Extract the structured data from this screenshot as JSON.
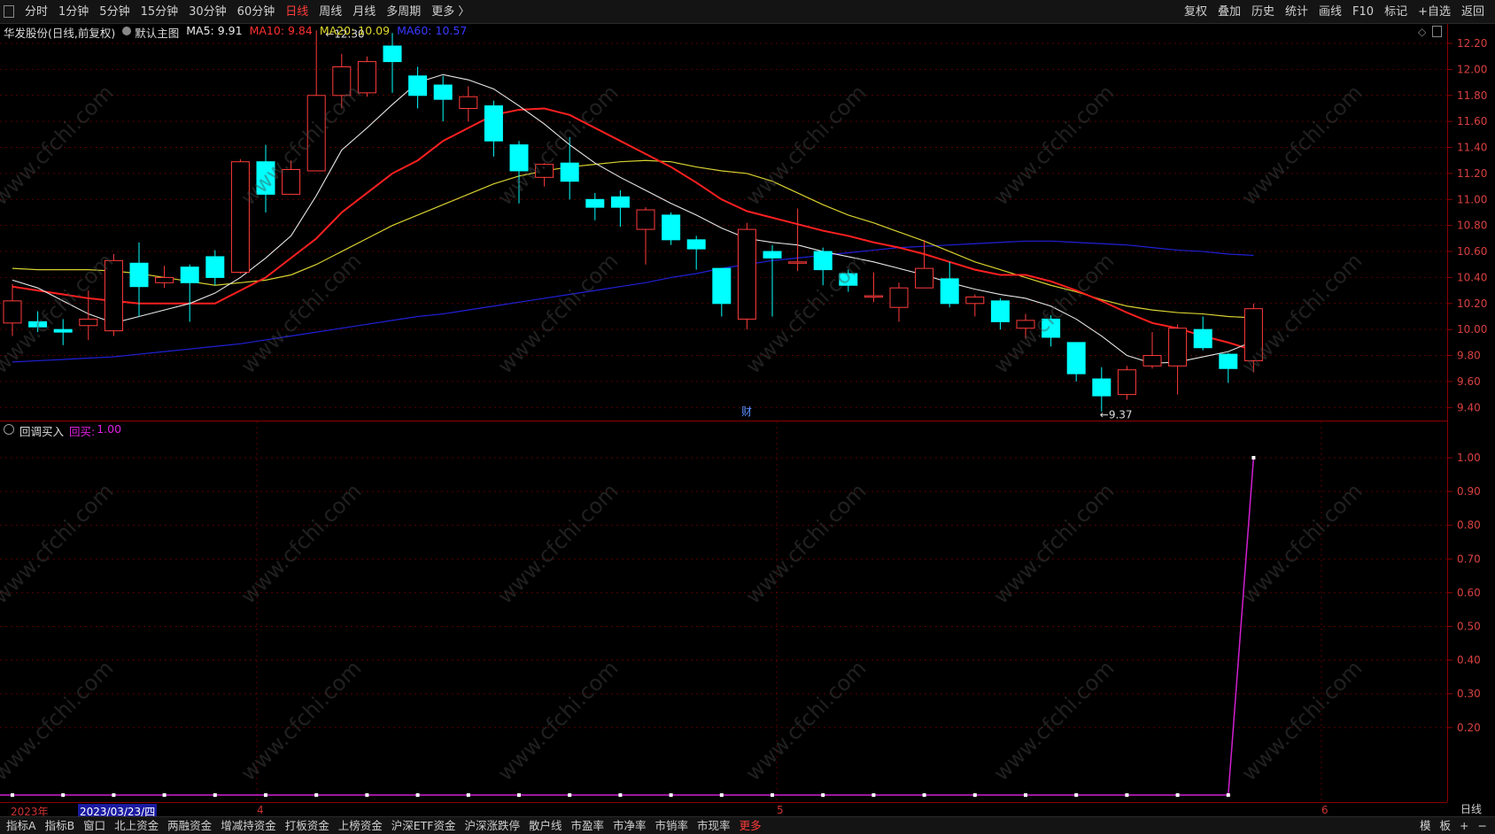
{
  "toolbar": {
    "left": [
      "分时",
      "1分钟",
      "5分钟",
      "15分钟",
      "30分钟",
      "60分钟",
      "日线",
      "周线",
      "月线",
      "多周期",
      "更多 〉"
    ],
    "active": "日线",
    "right": [
      "复权",
      "叠加",
      "历史",
      "统计",
      "画线",
      "F10",
      "标记",
      "+自选",
      "返回"
    ]
  },
  "infobar": {
    "stock": "华发股份",
    "mode": "(日线,前复权)",
    "template": "默认主图",
    "ma5": "MA5: 9.91",
    "ma10": "MA10: 9.84",
    "ma20": "MA20: 10.09",
    "ma60": "MA60: 10.57"
  },
  "colors": {
    "up": "#ff3b3b",
    "down": "#00ffff",
    "ma5": "#e8e8e8",
    "ma10": "#ff2020",
    "ma20": "#d8d030",
    "ma60": "#2020d8",
    "signal": "#d020d0"
  },
  "price_axis": [
    "12.20",
    "12.00",
    "11.80",
    "11.60",
    "11.40",
    "11.20",
    "11.00",
    "10.80",
    "10.60",
    "10.40",
    "10.20",
    "10.00",
    "9.80",
    "9.60",
    "9.40"
  ],
  "annotations": {
    "high": "12.30",
    "low": "9.37",
    "cai": "财"
  },
  "indicator": {
    "name": "回调买入",
    "label": "回买:",
    "value": "1.00"
  },
  "indicator_axis": [
    "1.00",
    "0.90",
    "0.80",
    "0.70",
    "0.60",
    "0.50",
    "0.40",
    "0.30",
    "0.20"
  ],
  "dates": {
    "year": "2023年",
    "selected": "2023/03/23/四",
    "m4": "4",
    "m5": "5",
    "m6": "6"
  },
  "day_label": "日线",
  "bottom_tabs": [
    "指标A",
    "指标B",
    "窗口",
    "北上资金",
    "两融资金",
    "增减持资金",
    "打板资金",
    "上榜资金",
    "沪深ETF资金",
    "沪深涨跌停",
    "散户线",
    "市盈率",
    "市净率",
    "市销率",
    "市现率",
    "更多"
  ],
  "bottom_right": [
    "模",
    "板",
    "+",
    "−"
  ],
  "watermark": "www.cfchi.com",
  "chart_data": {
    "type": "candlestick",
    "ylim": [
      9.3,
      12.35
    ],
    "candles": [
      {
        "o": 10.05,
        "c": 10.22,
        "h": 10.35,
        "l": 9.95
      },
      {
        "o": 10.06,
        "c": 10.02,
        "h": 10.14,
        "l": 9.98
      },
      {
        "o": 10.0,
        "c": 9.98,
        "h": 10.08,
        "l": 9.88
      },
      {
        "o": 10.03,
        "c": 10.08,
        "h": 10.3,
        "l": 9.92
      },
      {
        "o": 9.99,
        "c": 10.53,
        "h": 10.58,
        "l": 9.95
      },
      {
        "o": 10.51,
        "c": 10.33,
        "h": 10.67,
        "l": 10.1
      },
      {
        "o": 10.36,
        "c": 10.4,
        "h": 10.49,
        "l": 10.32
      },
      {
        "o": 10.48,
        "c": 10.36,
        "h": 10.5,
        "l": 10.06
      },
      {
        "o": 10.56,
        "c": 10.4,
        "h": 10.61,
        "l": 10.34
      },
      {
        "o": 10.44,
        "c": 11.29,
        "h": 11.31,
        "l": 10.43
      },
      {
        "o": 11.29,
        "c": 11.04,
        "h": 11.42,
        "l": 10.9
      },
      {
        "o": 11.04,
        "c": 11.23,
        "h": 11.3,
        "l": 11.04
      },
      {
        "o": 11.22,
        "c": 11.8,
        "h": 12.3,
        "l": 11.22
      },
      {
        "o": 11.8,
        "c": 12.02,
        "h": 12.12,
        "l": 11.7
      },
      {
        "o": 11.82,
        "c": 12.06,
        "h": 12.1,
        "l": 11.79
      },
      {
        "o": 12.18,
        "c": 12.06,
        "h": 12.28,
        "l": 11.82
      },
      {
        "o": 11.95,
        "c": 11.8,
        "h": 12.02,
        "l": 11.7
      },
      {
        "o": 11.88,
        "c": 11.77,
        "h": 11.95,
        "l": 11.6
      },
      {
        "o": 11.7,
        "c": 11.79,
        "h": 11.87,
        "l": 11.6
      },
      {
        "o": 11.72,
        "c": 11.45,
        "h": 11.76,
        "l": 11.33
      },
      {
        "o": 11.42,
        "c": 11.22,
        "h": 11.45,
        "l": 10.97
      },
      {
        "o": 11.17,
        "c": 11.27,
        "h": 11.28,
        "l": 11.1
      },
      {
        "o": 11.28,
        "c": 11.14,
        "h": 11.48,
        "l": 11.0
      },
      {
        "o": 11.0,
        "c": 10.94,
        "h": 11.05,
        "l": 10.84
      },
      {
        "o": 11.02,
        "c": 10.94,
        "h": 11.07,
        "l": 10.79
      },
      {
        "o": 10.77,
        "c": 10.92,
        "h": 10.94,
        "l": 10.5
      },
      {
        "o": 10.88,
        "c": 10.69,
        "h": 10.9,
        "l": 10.65
      },
      {
        "o": 10.69,
        "c": 10.62,
        "h": 10.72,
        "l": 10.46
      },
      {
        "o": 10.47,
        "c": 10.2,
        "h": 10.47,
        "l": 10.1
      },
      {
        "o": 10.08,
        "c": 10.77,
        "h": 10.82,
        "l": 10.0
      },
      {
        "o": 10.6,
        "c": 10.55,
        "h": 10.65,
        "l": 10.1
      },
      {
        "o": 10.52,
        "c": 10.52,
        "h": 10.93,
        "l": 10.45
      },
      {
        "o": 10.6,
        "c": 10.46,
        "h": 10.63,
        "l": 10.34
      },
      {
        "o": 10.43,
        "c": 10.34,
        "h": 10.46,
        "l": 10.29
      },
      {
        "o": 10.26,
        "c": 10.26,
        "h": 10.44,
        "l": 10.21
      },
      {
        "o": 10.17,
        "c": 10.32,
        "h": 10.36,
        "l": 10.06
      },
      {
        "o": 10.32,
        "c": 10.47,
        "h": 10.69,
        "l": 10.32
      },
      {
        "o": 10.39,
        "c": 10.2,
        "h": 10.52,
        "l": 10.17
      },
      {
        "o": 10.2,
        "c": 10.25,
        "h": 10.27,
        "l": 10.1
      },
      {
        "o": 10.22,
        "c": 10.06,
        "h": 10.24,
        "l": 10.0
      },
      {
        "o": 10.01,
        "c": 10.07,
        "h": 10.12,
        "l": 9.93
      },
      {
        "o": 10.08,
        "c": 9.94,
        "h": 10.11,
        "l": 9.87
      },
      {
        "o": 9.9,
        "c": 9.66,
        "h": 9.9,
        "l": 9.6
      },
      {
        "o": 9.62,
        "c": 9.49,
        "h": 9.71,
        "l": 9.37
      },
      {
        "o": 9.5,
        "c": 9.69,
        "h": 9.72,
        "l": 9.46
      },
      {
        "o": 9.72,
        "c": 9.8,
        "h": 9.98,
        "l": 9.7
      },
      {
        "o": 9.72,
        "c": 10.01,
        "h": 10.04,
        "l": 9.5
      },
      {
        "o": 10.0,
        "c": 9.86,
        "h": 10.1,
        "l": 9.84
      },
      {
        "o": 9.81,
        "c": 9.7,
        "h": 9.82,
        "l": 9.59
      },
      {
        "o": 9.76,
        "c": 10.16,
        "h": 10.2,
        "l": 9.67
      }
    ],
    "ma5": [
      10.38,
      10.32,
      10.22,
      10.12,
      10.05,
      10.1,
      10.15,
      10.2,
      10.28,
      10.4,
      10.55,
      10.72,
      11.03,
      11.38,
      11.55,
      11.73,
      11.9,
      11.96,
      11.92,
      11.85,
      11.72,
      11.58,
      11.42,
      11.28,
      11.17,
      11.07,
      10.97,
      10.88,
      10.78,
      10.7,
      10.67,
      10.65,
      10.6,
      10.56,
      10.52,
      10.47,
      10.42,
      10.36,
      10.31,
      10.27,
      10.24,
      10.18,
      10.08,
      9.95,
      9.8,
      9.74,
      9.75,
      9.79,
      9.83,
      9.91
    ],
    "ma10": [
      10.33,
      10.3,
      10.27,
      10.24,
      10.22,
      10.2,
      10.2,
      10.2,
      10.2,
      10.3,
      10.4,
      10.55,
      10.7,
      10.9,
      11.05,
      11.2,
      11.3,
      11.45,
      11.55,
      11.65,
      11.69,
      11.7,
      11.65,
      11.55,
      11.45,
      11.35,
      11.25,
      11.13,
      11.0,
      10.91,
      10.86,
      10.81,
      10.76,
      10.72,
      10.67,
      10.63,
      10.58,
      10.52,
      10.46,
      10.42,
      10.42,
      10.37,
      10.3,
      10.22,
      10.13,
      10.05,
      10.01,
      9.95,
      9.9,
      9.84
    ],
    "ma20": [
      10.47,
      10.46,
      10.46,
      10.46,
      10.45,
      10.43,
      10.4,
      10.37,
      10.34,
      10.36,
      10.38,
      10.42,
      10.5,
      10.6,
      10.7,
      10.8,
      10.88,
      10.96,
      11.04,
      11.12,
      11.18,
      11.22,
      11.25,
      11.27,
      11.29,
      11.3,
      11.29,
      11.25,
      11.22,
      11.2,
      11.14,
      11.05,
      10.96,
      10.88,
      10.82,
      10.75,
      10.68,
      10.6,
      10.52,
      10.46,
      10.4,
      10.34,
      10.29,
      10.23,
      10.18,
      10.15,
      10.13,
      10.12,
      10.1,
      10.09
    ],
    "ma60": [
      9.75,
      9.76,
      9.77,
      9.78,
      9.79,
      9.81,
      9.83,
      9.85,
      9.87,
      9.89,
      9.92,
      9.95,
      9.98,
      10.01,
      10.04,
      10.07,
      10.1,
      10.12,
      10.15,
      10.18,
      10.21,
      10.24,
      10.27,
      10.3,
      10.33,
      10.36,
      10.4,
      10.43,
      10.47,
      10.5,
      10.53,
      10.55,
      10.57,
      10.59,
      10.61,
      10.63,
      10.64,
      10.65,
      10.66,
      10.67,
      10.68,
      10.68,
      10.67,
      10.66,
      10.65,
      10.63,
      10.61,
      10.6,
      10.58,
      10.57
    ],
    "signal": [
      0,
      0,
      0,
      0,
      0,
      0,
      0,
      0,
      0,
      0,
      0,
      0,
      0,
      0,
      0,
      0,
      0,
      0,
      0,
      0,
      0,
      0,
      0,
      0,
      0,
      0,
      0,
      0,
      0,
      0,
      0,
      0,
      0,
      0,
      0,
      0,
      0,
      0,
      0,
      0,
      0,
      0,
      0,
      0,
      0,
      0,
      0,
      0,
      0,
      1.0
    ],
    "signal_ylim": [
      0,
      1.05
    ]
  }
}
